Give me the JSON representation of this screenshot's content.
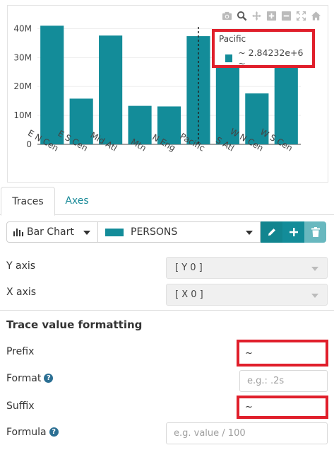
{
  "chart": {
    "modebar_icons": [
      "camera-icon",
      "zoom-icon",
      "pan-icon",
      "zoom-in-icon",
      "zoom-out-icon",
      "autoscale-icon",
      "home-icon"
    ],
    "tooltip": {
      "name": "Pacific",
      "value": "~ 2.84232e+6 ~"
    }
  },
  "chart_data": {
    "type": "bar",
    "categories": [
      "E N Cen",
      "E S Cen",
      "Mid Atl",
      "Mtn",
      "N Eng",
      "Pacific",
      "S Atl",
      "W N Cen",
      "W S Cen"
    ],
    "series": [
      {
        "values": [
          41000000,
          15800000,
          37600000,
          13300000,
          13100000,
          37400000,
          30600000,
          17600000,
          26600000
        ]
      }
    ],
    "ytick_labels": [
      "0",
      "10M",
      "20M",
      "30M",
      "40M"
    ],
    "ylim": [
      0,
      45000000
    ],
    "bar_color": "#138c99",
    "hover_category": "Pacific",
    "xlabel": "",
    "ylabel": ""
  },
  "tabs": {
    "traces": "Traces",
    "axes": "Axes"
  },
  "trace_selector": {
    "chart_type": "Bar Chart",
    "trace_name": "PERSONS"
  },
  "form": {
    "y_axis_label": "Y axis",
    "y_axis_value": "[ Y 0 ]",
    "x_axis_label": "X axis",
    "x_axis_value": "[ X 0 ]",
    "section_title": "Trace value formatting",
    "prefix_label": "Prefix",
    "prefix_value": "~",
    "format_label": "Format",
    "format_placeholder": "e.g.: .2s",
    "suffix_label": "Suffix",
    "suffix_value": "~",
    "formula_label": "Formula",
    "formula_placeholder": "e.g. value / 100"
  },
  "colors": {
    "accent": "#138c99",
    "highlight": "#e01f2b",
    "link": "#1b8b99"
  }
}
